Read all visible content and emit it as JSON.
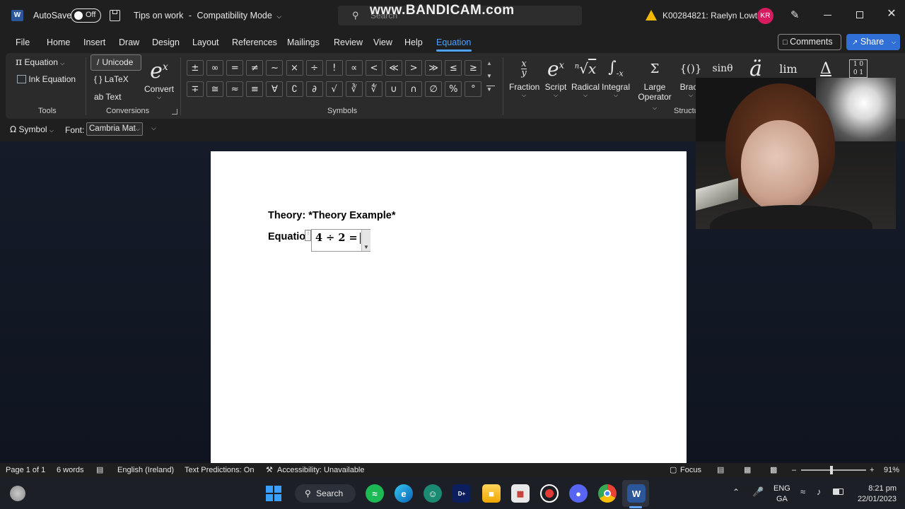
{
  "titlebar": {
    "autosave_label": "AutoSave",
    "autosave_state": "Off",
    "doc_title": "Tips on work",
    "separator": "-",
    "mode": "Compatibility Mode",
    "search_placeholder": "Search",
    "watermark": "www.BANDICAM.com",
    "user": "K00284821: Raelyn Lowth",
    "user_initials": "KR"
  },
  "menu": {
    "items": [
      "File",
      "Home",
      "Insert",
      "Draw",
      "Design",
      "Layout",
      "References",
      "Mailings",
      "Review",
      "View",
      "Help",
      "Equation"
    ],
    "active": "Equation",
    "comments_label": "Comments",
    "share_label": "Share"
  },
  "ribbon": {
    "tools": {
      "equation_label": "Equation",
      "ink_equation_label": "Ink Equation",
      "group_label": "Tools"
    },
    "conversions": {
      "unicode_label": "Unicode",
      "latex_label": "LaTeX",
      "text_label": "Text",
      "convert_label": "Convert",
      "group_label": "Conversions"
    },
    "symbols": {
      "row1": [
        "±",
        "∞",
        "=",
        "≠",
        "~",
        "×",
        "÷",
        "!",
        "∝",
        "<",
        "≪",
        ">",
        "≫",
        "≤",
        "≥"
      ],
      "row2": [
        "∓",
        "≅",
        "≈",
        "≡",
        "∀",
        "∁",
        "∂",
        "√",
        "∛",
        "∜",
        "∪",
        "∩",
        "∅",
        "%",
        "°"
      ],
      "group_label": "Symbols"
    },
    "structures": {
      "items": [
        {
          "label": "Fraction",
          "glyph": "x/y"
        },
        {
          "label": "Script",
          "glyph": "eˣ"
        },
        {
          "label": "Radical",
          "glyph": "ⁿ√x"
        },
        {
          "label": "Integral",
          "glyph": "∫"
        },
        {
          "label": "Large Operator",
          "glyph": "Σ"
        },
        {
          "label": "Brack",
          "glyph": "{()}"
        }
      ],
      "extra_glyphs": [
        "sinθ",
        "ä",
        "lim",
        "Δ",
        "[10]"
      ],
      "group_label": "Structu"
    }
  },
  "eqbar": {
    "symbol_label": "Symbol",
    "font_label": "Font:",
    "font_value": "Cambria Mat"
  },
  "document": {
    "line1": "Theory: *Theory Example*",
    "line2_prefix": "Equatio",
    "equation": "4 ÷ 2 ="
  },
  "status": {
    "page": "Page 1 of 1",
    "words": "6 words",
    "language": "English (Ireland)",
    "predictions": "Text Predictions: On",
    "accessibility": "Accessibility: Unavailable",
    "focus": "Focus",
    "zoom": "91%"
  },
  "taskbar": {
    "search_label": "Search",
    "lang_top": "ENG",
    "lang_bottom": "GA",
    "time": "8:21 pm",
    "date": "22/01/2023"
  },
  "colors": {
    "accent": "#4da3ff",
    "share_bg": "#2f6fd6",
    "avatar": "#d81b60",
    "warning": "#f5b800"
  }
}
